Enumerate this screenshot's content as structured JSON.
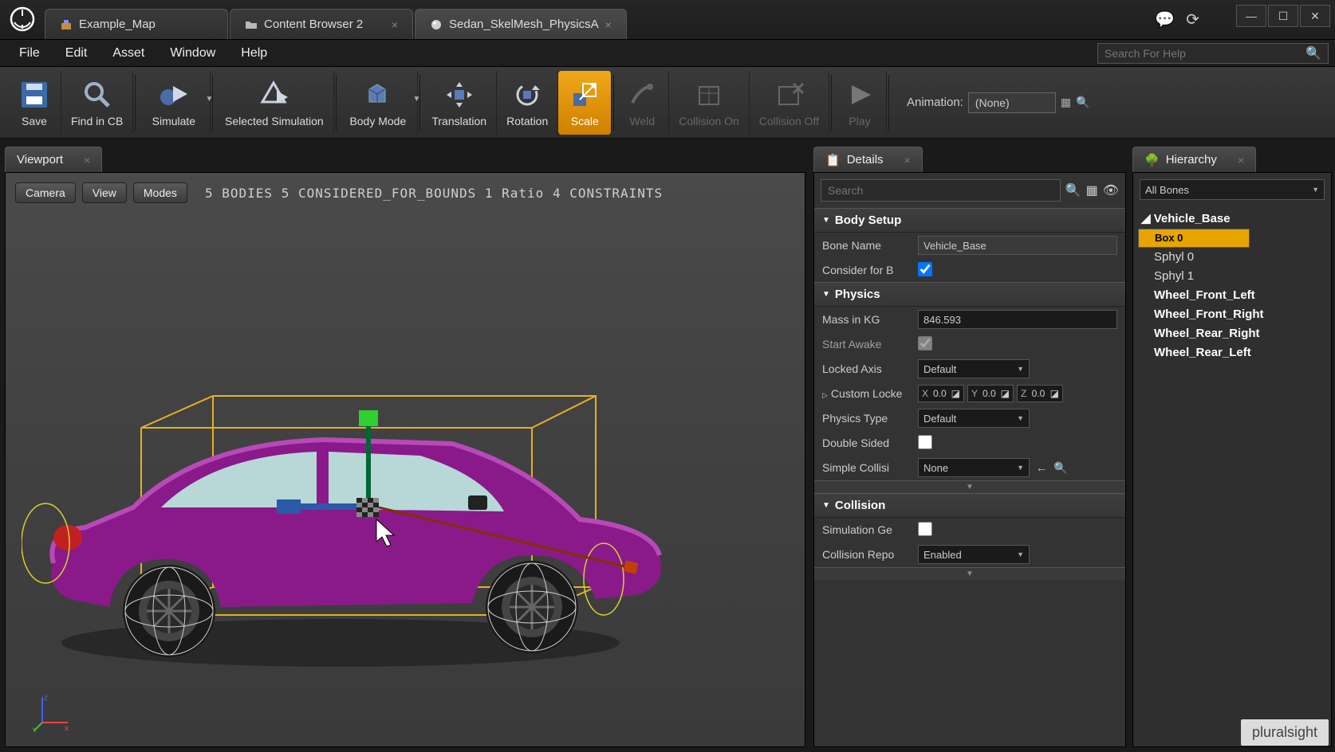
{
  "tabs": [
    {
      "label": "Example_Map"
    },
    {
      "label": "Content Browser 2"
    },
    {
      "label": "Sedan_SkelMesh_PhysicsA"
    }
  ],
  "menu": {
    "file": "File",
    "edit": "Edit",
    "asset": "Asset",
    "window": "Window",
    "help": "Help"
  },
  "help_placeholder": "Search For Help",
  "toolbar": {
    "save": "Save",
    "findcb": "Find in CB",
    "sim": "Simulate",
    "selsim": "Selected Simulation",
    "bodymode": "Body Mode",
    "trans": "Translation",
    "rot": "Rotation",
    "scale": "Scale",
    "weld": "Weld",
    "collon": "Collision On",
    "colloff": "Collision Off",
    "play": "Play",
    "anim_label": "Animation:",
    "anim_value": "(None)"
  },
  "viewport": {
    "tab": "Viewport",
    "btn_camera": "Camera",
    "btn_view": "View",
    "btn_modes": "Modes",
    "stats": "5 BODIES  5 CONSIDERED_FOR_BOUNDS  1 Ratio  4 CONSTRAINTS"
  },
  "details": {
    "tab": "Details",
    "search_placeholder": "Search",
    "cat_bodysetup": "Body Setup",
    "bone_name_label": "Bone Name",
    "bone_name_value": "Vehicle_Base",
    "consider_label": "Consider for B",
    "cat_physics": "Physics",
    "mass_label": "Mass in KG",
    "mass_value": "846.593",
    "startawake_label": "Start Awake",
    "lockedaxis_label": "Locked Axis",
    "lockedaxis_value": "Default",
    "customlocked_label": "Custom Locke",
    "x_label": "X",
    "x_val": "0.0",
    "y_label": "Y",
    "y_val": "0.0",
    "z_label": "Z",
    "z_val": "0.0",
    "phystype_label": "Physics Type",
    "phystype_value": "Default",
    "doublesided_label": "Double Sided",
    "simplecoll_label": "Simple Collisi",
    "simplecoll_value": "None",
    "cat_collision": "Collision",
    "simgen_label": "Simulation Ge",
    "collrep_label": "Collision Repo",
    "collrep_value": "Enabled"
  },
  "hierarchy": {
    "tab": "Hierarchy",
    "filter": "All Bones",
    "items": [
      {
        "label": "Vehicle_Base",
        "indent": 0,
        "bold": true,
        "sel": false,
        "tri": true
      },
      {
        "label": "Box 0",
        "indent": 1,
        "bold": true,
        "sel": true
      },
      {
        "label": "Sphyl 0",
        "indent": 1,
        "bold": false,
        "sel": false
      },
      {
        "label": "Sphyl 1",
        "indent": 1,
        "bold": false,
        "sel": false
      },
      {
        "label": "Wheel_Front_Left",
        "indent": 1,
        "bold": true,
        "sel": false
      },
      {
        "label": "Wheel_Front_Right",
        "indent": 1,
        "bold": true,
        "sel": false
      },
      {
        "label": "Wheel_Rear_Right",
        "indent": 1,
        "bold": true,
        "sel": false
      },
      {
        "label": "Wheel_Rear_Left",
        "indent": 1,
        "bold": true,
        "sel": false
      }
    ]
  },
  "watermark": "pluralsight"
}
